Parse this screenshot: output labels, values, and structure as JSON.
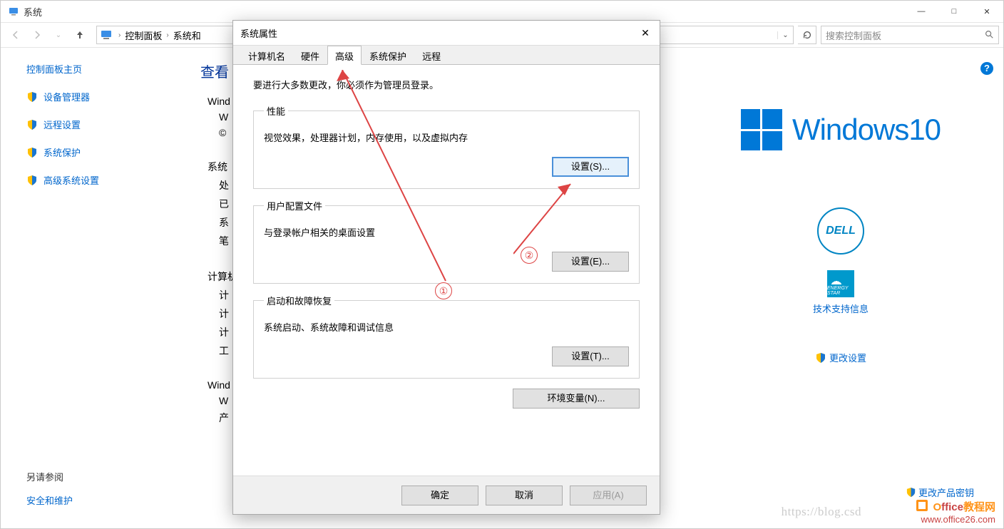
{
  "parent": {
    "title": "系统",
    "win_buttons": {
      "min": "—",
      "max": "□",
      "close": "✕"
    },
    "breadcrumb": {
      "root": "控制面板",
      "sub": "系统和"
    },
    "search_placeholder": "搜索控制面板"
  },
  "sidebar": {
    "home": "控制面板主页",
    "items": [
      {
        "label": "设备管理器"
      },
      {
        "label": "远程设置"
      },
      {
        "label": "系统保护"
      },
      {
        "label": "高级系统设置"
      }
    ],
    "see_also": "另请参阅",
    "security": "安全和维护"
  },
  "main": {
    "heading": "查看",
    "lines": {
      "l1": "Wind",
      "l2": "W",
      "l3": "©",
      "l4": "系统",
      "l5": "处",
      "l6": "已",
      "l7": "系",
      "l8": "笔",
      "l9": "计算机",
      "l10": "计",
      "l11": "计",
      "l12": "计",
      "l13": "工",
      "l14": "Wind",
      "l15": "W",
      "l16": "产"
    }
  },
  "right": {
    "windows_text": "Windows10",
    "dell": "DELL",
    "energy": "ENERGY STAR",
    "tech_link": "技术支持信息",
    "change_link": "更改设置"
  },
  "help": "?",
  "dialog": {
    "title": "系统属性",
    "close": "✕",
    "tabs": [
      "计算机名",
      "硬件",
      "高级",
      "系统保护",
      "远程"
    ],
    "active_tab": 2,
    "admin_note": "要进行大多数更改，你必须作为管理员登录。",
    "perf": {
      "legend": "性能",
      "desc": "视觉效果，处理器计划，内存使用，以及虚拟内存",
      "btn": "设置(S)..."
    },
    "profile": {
      "legend": "用户配置文件",
      "desc": "与登录帐户相关的桌面设置",
      "btn": "设置(E)..."
    },
    "startup": {
      "legend": "启动和故障恢复",
      "desc": "系统启动、系统故障和调试信息",
      "btn": "设置(T)..."
    },
    "env_btn": "环境变量(N)...",
    "footer": {
      "ok": "确定",
      "cancel": "取消",
      "apply": "应用(A)"
    }
  },
  "annotations": {
    "c1": "①",
    "c2": "②"
  },
  "watermark": {
    "brand_a": "O",
    "brand_b": "ffice",
    "brand_c": "教程网",
    "url": "www.office26.com",
    "note": "更改产品密钥"
  },
  "blog": "https://blog.csd"
}
